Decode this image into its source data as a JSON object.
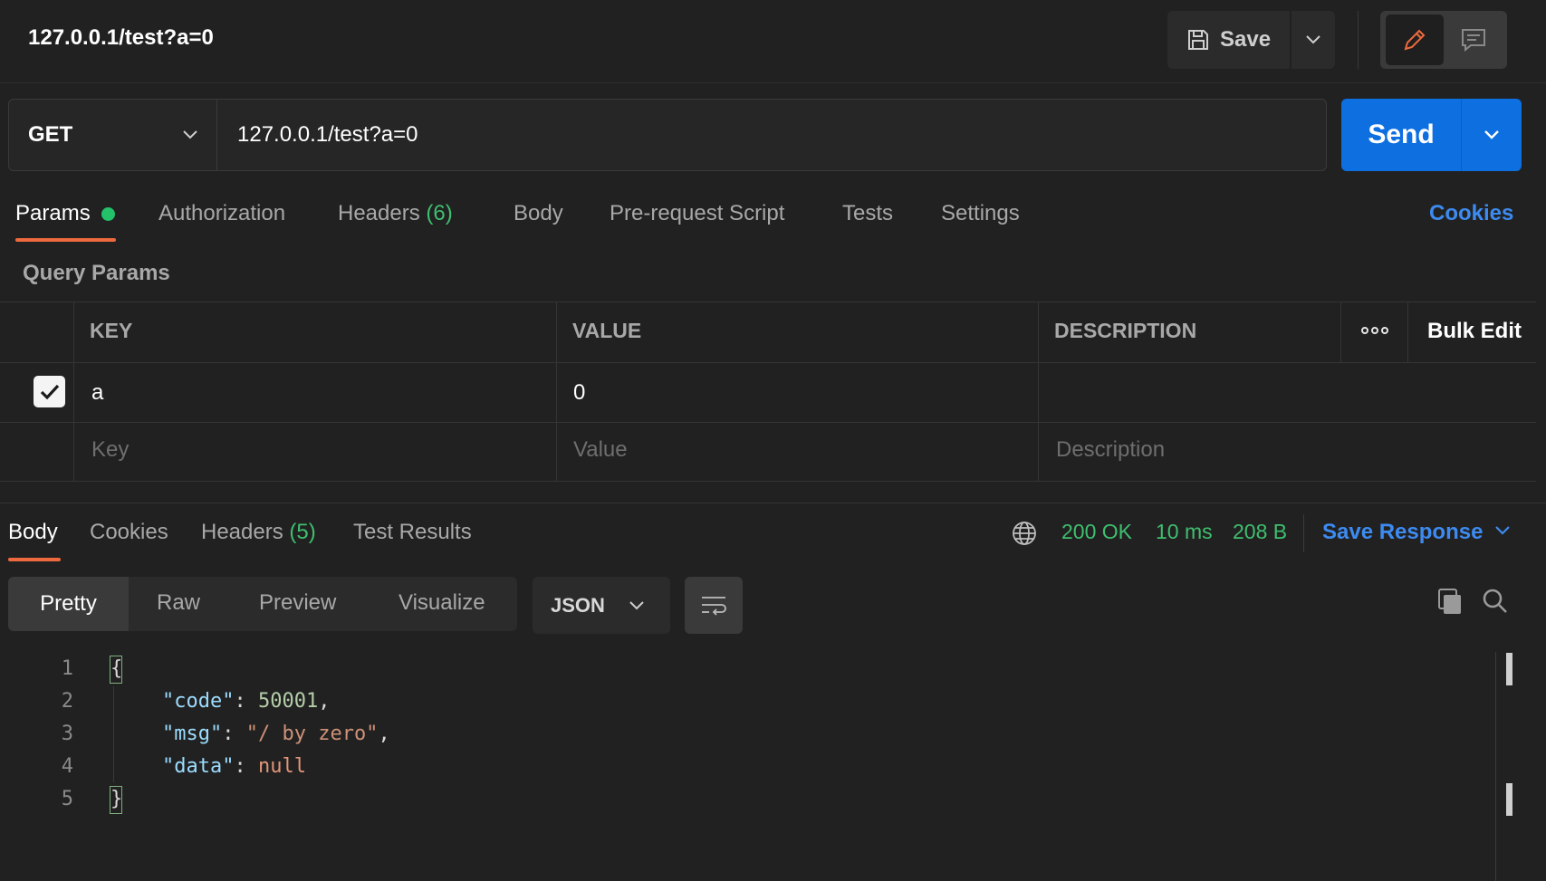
{
  "header": {
    "title": "127.0.0.1/test?a=0",
    "save_label": "Save"
  },
  "request": {
    "method": "GET",
    "url": "127.0.0.1/test?a=0",
    "send_label": "Send"
  },
  "request_tabs": {
    "params": "Params",
    "authorization": "Authorization",
    "headers": "Headers",
    "headers_count": "(6)",
    "body": "Body",
    "pre_request_script": "Pre-request Script",
    "tests": "Tests",
    "settings": "Settings",
    "cookies": "Cookies"
  },
  "query_params": {
    "section_label": "Query Params",
    "columns": {
      "key": "KEY",
      "value": "VALUE",
      "description": "DESCRIPTION"
    },
    "bulk_edit": "Bulk Edit",
    "rows": [
      {
        "enabled": true,
        "key": "a",
        "value": "0",
        "description": ""
      }
    ],
    "placeholders": {
      "key": "Key",
      "value": "Value",
      "description": "Description"
    }
  },
  "response": {
    "tabs": {
      "body": "Body",
      "cookies": "Cookies",
      "headers": "Headers",
      "headers_count": "(5)",
      "test_results": "Test Results"
    },
    "status": "200 OK",
    "time": "10 ms",
    "size": "208 B",
    "save_response": "Save Response",
    "views": {
      "pretty": "Pretty",
      "raw": "Raw",
      "preview": "Preview",
      "visualize": "Visualize"
    },
    "format": "JSON",
    "line_numbers": [
      "1",
      "2",
      "3",
      "4",
      "5"
    ],
    "json": {
      "open_brace": "{",
      "close_brace": "}",
      "line2_key": "\"code\"",
      "line2_value": "50001",
      "line3_key": "\"msg\"",
      "line3_value": "\"/ by zero\"",
      "line4_key": "\"data\"",
      "line4_value": "null"
    }
  },
  "colors": {
    "accent_orange": "#ee6a3e",
    "send_blue": "#0d6fe0",
    "link_blue": "#3d8bf0",
    "status_green": "#3fbf6f"
  }
}
